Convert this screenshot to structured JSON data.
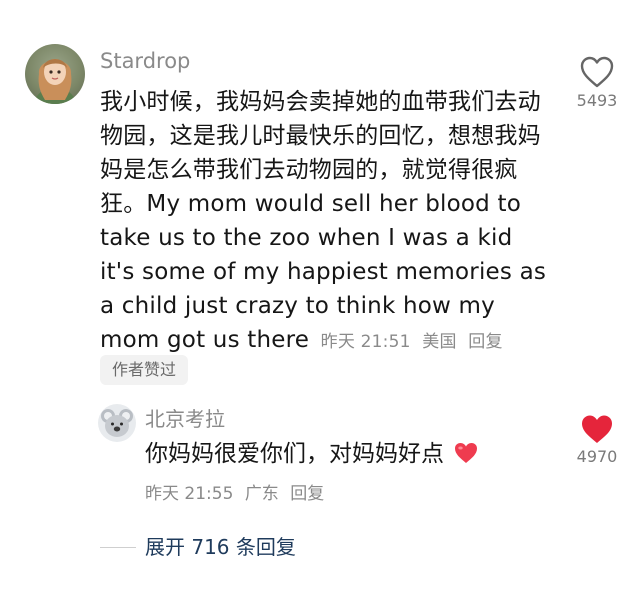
{
  "comment": {
    "username": "Stardrop",
    "text": "我小时候，我妈妈会卖掉她的血带我们去动物园，这是我儿时最快乐的回忆，想想我妈妈是怎么带我们去动物园的，就觉得很疯狂。My mom would sell her blood to take us to the zoo when I was a kid it's some of my happiest memories as a child just crazy to think how my mom got us there",
    "time": "昨天 21:51",
    "location": "美国",
    "reply_label": "回复",
    "author_liked": "作者赞过",
    "like_count": "5493",
    "like_icon": "heart-outline-icon"
  },
  "reply": {
    "username": "北京考拉",
    "text": "你妈妈很爱你们，对妈妈好点",
    "emoji_icon": "red-heart-emoji-icon",
    "time": "昨天 21:55",
    "location": "广东",
    "reply_label": "回复",
    "like_count": "4970",
    "like_icon": "heart-filled-icon",
    "like_color": "#e5253b"
  },
  "expand": {
    "label": "展开 716 条回复"
  }
}
